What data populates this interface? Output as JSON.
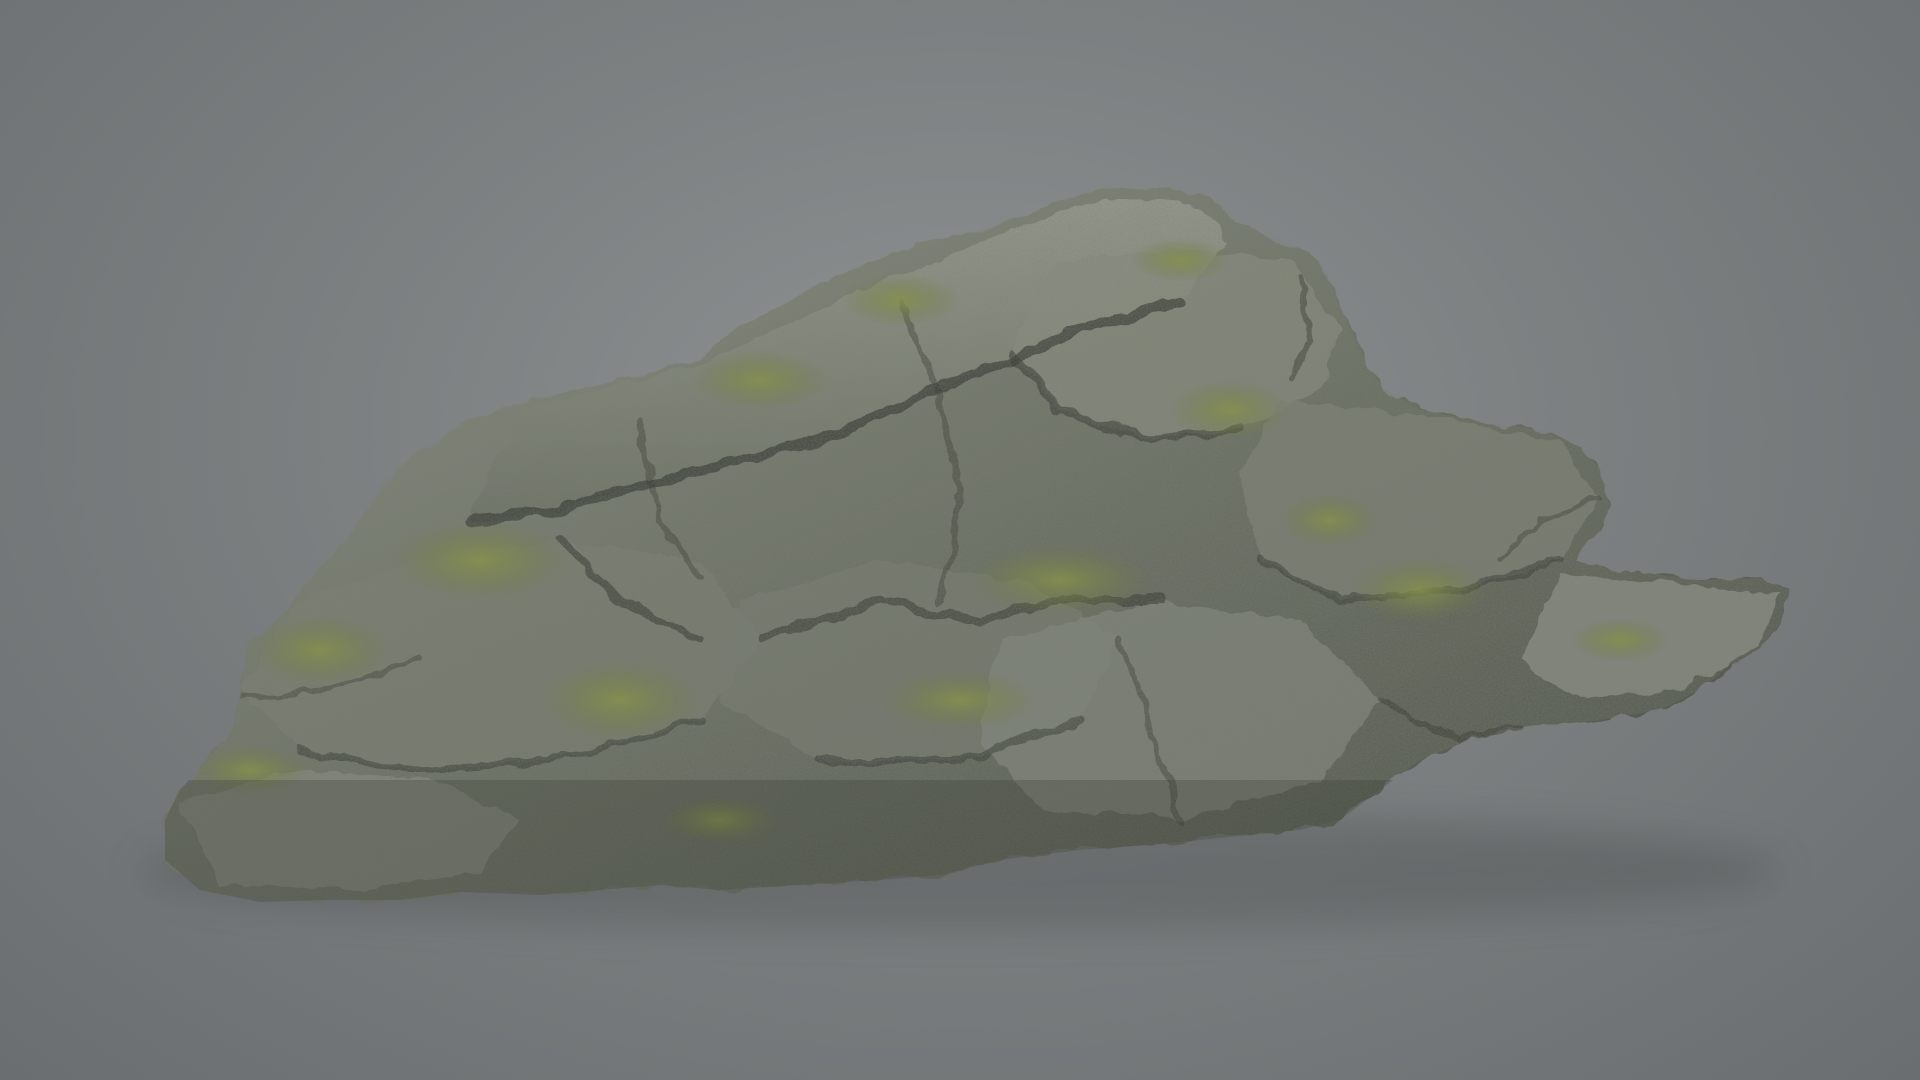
{
  "scene": {
    "subject_icon": "rock-icon",
    "colors": {
      "background_center": "#8d9192",
      "background_edge": "#6a6e70",
      "rock_light": "#9a9e94",
      "rock_mid": "#6f7468",
      "rock_dark": "#3d4139",
      "moss": "#7f8a3a",
      "moss_dark": "#5c6a2a"
    }
  }
}
